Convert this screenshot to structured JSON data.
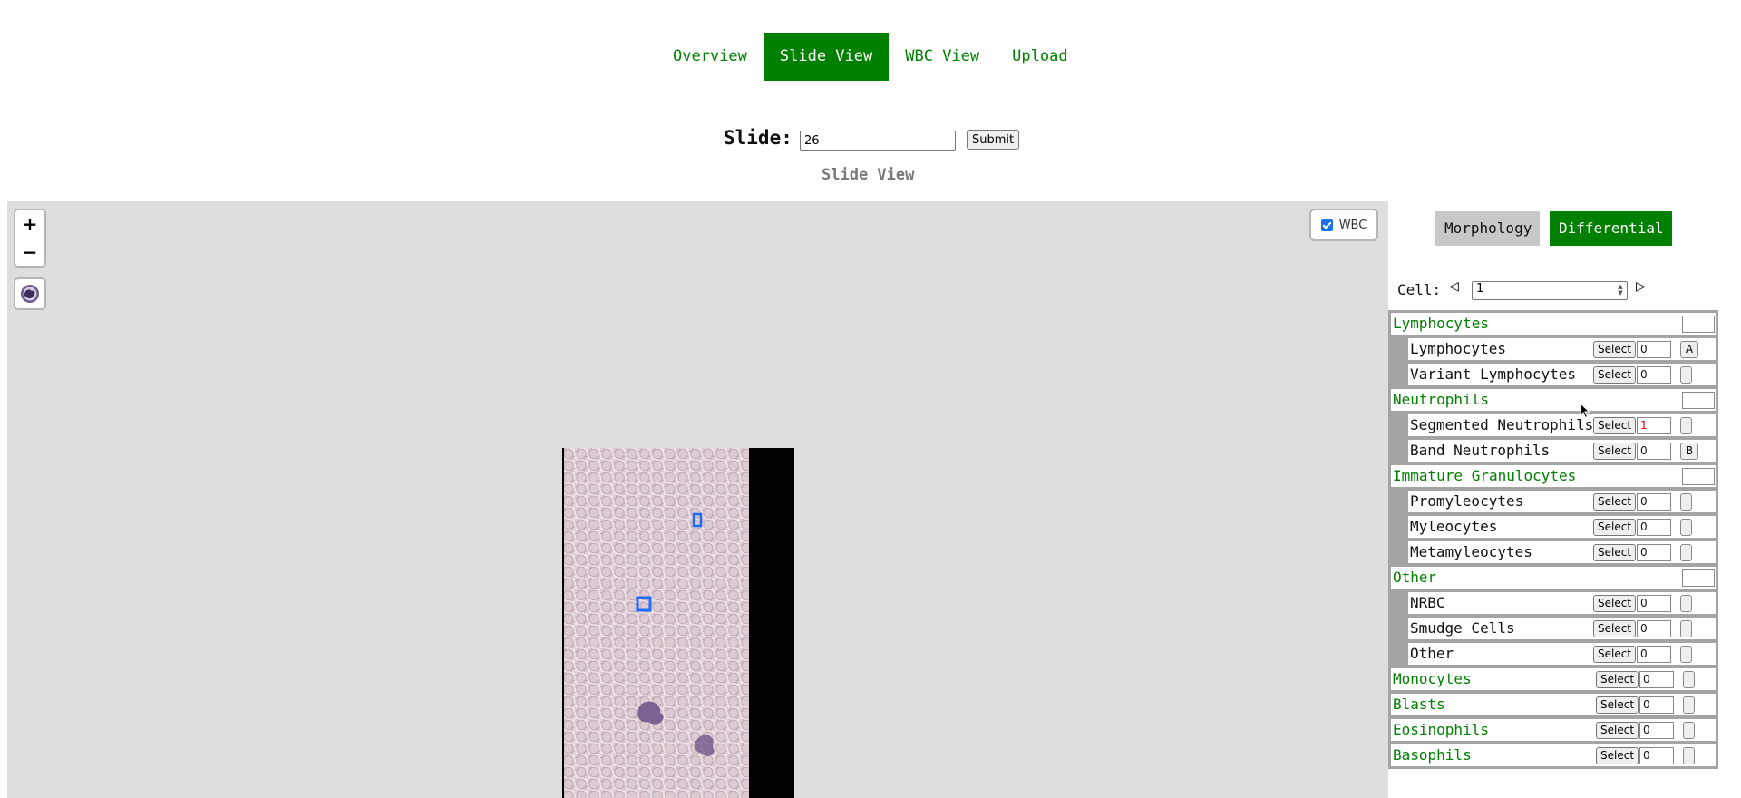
{
  "nav": {
    "items": [
      {
        "label": "Overview",
        "active": false
      },
      {
        "label": "Slide View",
        "active": true
      },
      {
        "label": "WBC View",
        "active": false
      },
      {
        "label": "Upload",
        "active": false
      }
    ]
  },
  "slide_form": {
    "label": "Slide:",
    "value": "26",
    "submit_label": "Submit"
  },
  "view_title": "Slide View",
  "map": {
    "zoom_in": "+",
    "zoom_out": "−",
    "wbc_toggle": {
      "label": "WBC",
      "checked": true
    },
    "layer_icon": "blood-cell-icon"
  },
  "panel": {
    "tabs": [
      {
        "label": "Morphology",
        "active": false
      },
      {
        "label": "Differential",
        "active": true
      }
    ],
    "cell_label": "Cell:",
    "cell_prev": "◁",
    "cell_next": "▷",
    "cell_value": "1",
    "select_label": "Select",
    "rows": [
      {
        "label": "Lymphocytes",
        "kind": "group"
      },
      {
        "label": "Lymphocytes",
        "kind": "sub",
        "count": "0",
        "key": "A"
      },
      {
        "label": "Variant Lymphocytes",
        "kind": "sub",
        "count": "0",
        "key": ""
      },
      {
        "label": "Neutrophils",
        "kind": "group"
      },
      {
        "label": "Segmented Neutrophils",
        "kind": "sub",
        "count": "1",
        "key": "",
        "highlight": true
      },
      {
        "label": "Band Neutrophils",
        "kind": "sub",
        "count": "0",
        "key": "B"
      },
      {
        "label": "Immature Granulocytes",
        "kind": "group"
      },
      {
        "label": "Promyleocytes",
        "kind": "sub",
        "count": "0",
        "key": ""
      },
      {
        "label": "Myleocytes",
        "kind": "sub",
        "count": "0",
        "key": ""
      },
      {
        "label": "Metamyleocytes",
        "kind": "sub",
        "count": "0",
        "key": ""
      },
      {
        "label": "Other",
        "kind": "group"
      },
      {
        "label": "NRBC",
        "kind": "sub",
        "count": "0",
        "key": ""
      },
      {
        "label": "Smudge Cells",
        "kind": "sub",
        "count": "0",
        "key": ""
      },
      {
        "label": "Other",
        "kind": "sub",
        "count": "0",
        "key": ""
      },
      {
        "label": "Monocytes",
        "kind": "leafgroup",
        "count": "0",
        "key": ""
      },
      {
        "label": "Blasts",
        "kind": "leafgroup",
        "count": "0",
        "key": ""
      },
      {
        "label": "Eosinophils",
        "kind": "leafgroup",
        "count": "0",
        "key": ""
      },
      {
        "label": "Basophils",
        "kind": "leafgroup",
        "count": "0",
        "key": ""
      }
    ]
  },
  "colors": {
    "accent": "#008000",
    "map_bg": "#dedede",
    "highlight_count": "#e00000"
  }
}
